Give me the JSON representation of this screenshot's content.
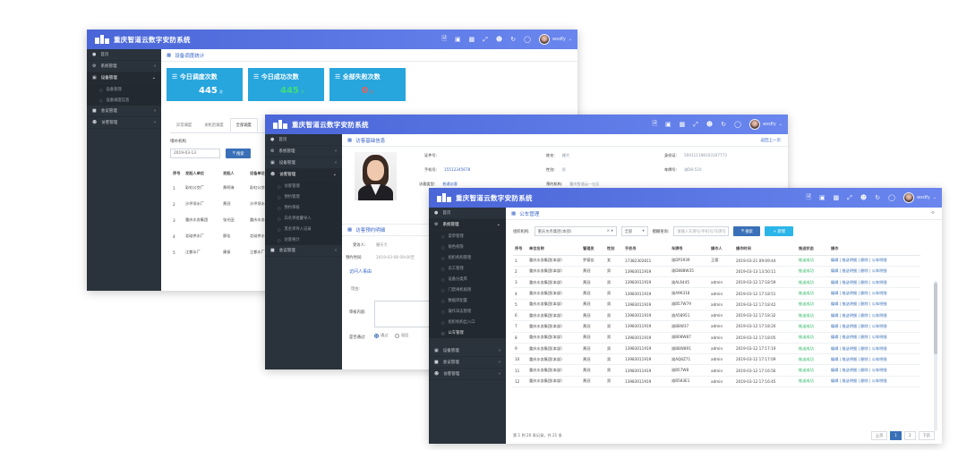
{
  "app_title": "重庆智道云数字安防系统",
  "user_name": "wxdfy",
  "topbar_icons": [
    "file-icon",
    "monitor-icon",
    "tv-icon",
    "expand-icon",
    "users-icon",
    "refresh-icon",
    "shield-icon"
  ],
  "window1": {
    "sidebar": [
      "首页",
      "系统管理",
      "设备管理",
      "设备管理",
      "设备调度信息",
      "会议管理",
      "访客管理"
    ],
    "panel_title": "设备调度统计",
    "tiles": [
      {
        "title": "今日调度次数",
        "value": "445",
        "unit": "次"
      },
      {
        "title": "今日成功次数",
        "value": "445",
        "unit": "次"
      },
      {
        "title": "全部失败次数",
        "value": "0",
        "unit": "次"
      }
    ],
    "tabs": [
      "异常调度",
      "关机后调度",
      "全部调度"
    ],
    "field_label": "增补机构",
    "date_value": "2019-03-13",
    "search_label": "搜索",
    "headers": [
      "序号",
      "发起人单位",
      "发起人",
      "设备单位"
    ],
    "rows": [
      [
        "1",
        "彩虹公交厂",
        "黄明海",
        "彩虹公交厂"
      ],
      [
        "2",
        "沙坪坝水厂",
        "黄冠",
        "沙坪坝水厂"
      ],
      [
        "3",
        "重庆水务集团",
        "张光田",
        "重庆水务集团"
      ],
      [
        "4",
        "北碚供水厂",
        "廖佳",
        "北碚供水厂"
      ],
      [
        "5",
        "江都水厂",
        "康振",
        "江都水厂"
      ]
    ]
  },
  "window2": {
    "sidebar_top": [
      "首页",
      "系统管理",
      "设备管理",
      "访客管理"
    ],
    "sidebar_sub": [
      "访客管理",
      "预约管理",
      "预约审核",
      "白名单批量导入",
      "黑名单导入记录",
      "访客统计"
    ],
    "sidebar_bottom": "会议管理",
    "panel_title": "访客基础信息",
    "back_link": "返回上一页",
    "fields": [
      {
        "k": "证件号:",
        "v": ""
      },
      {
        "k": "姓名:",
        "v": "姗大"
      },
      {
        "k": "身份证:",
        "v": "500111198103107773"
      },
      {
        "k": "手机号:",
        "v": "15512345678"
      },
      {
        "k": "性别:",
        "v": "男"
      },
      {
        "k": "车牌号:",
        "v": "渝D8-510"
      },
      {
        "k": "访客类型:",
        "v": "普通访客"
      },
      {
        "k": "预约机构:",
        "v": "重庆智道云一社区"
      }
    ],
    "form_title": "访客预约明细",
    "form_fields": [
      {
        "k": "受访人:",
        "v": "姗天大"
      },
      {
        "k": "预约时间:",
        "v": "2019-03-08 09:00至"
      }
    ],
    "visit_title": "访问人事由",
    "reason_label": "理由:",
    "opinion_label": "审核内容:",
    "approve_label": "是否通过:",
    "radio_yes": "通过",
    "radio_no": "驳回"
  },
  "window3": {
    "sidebar_top": [
      "首页",
      "系统管理"
    ],
    "sidebar_sub": [
      "菜单管理",
      "角色权限",
      "组织机构管理",
      "员工管理",
      "设备分类库",
      "门禁闸机规则",
      "数据库配置",
      "操作日志管理",
      "组织机构出入口",
      "公车管理"
    ],
    "sidebar_bottom": [
      "设备管理",
      "会议管理",
      "访客管理"
    ],
    "panel_title": "公车管理",
    "org_label": "组织机构:",
    "org_value": "重庆水务集团(本部)",
    "status_value": "全部",
    "keyword_label": "模糊查询:",
    "keyword_placeholder": "请输入车牌号/手机号/车牌号",
    "search_label": "搜索",
    "add_label": "+ 新增",
    "headers": [
      "序号",
      "单位名称",
      "管理员",
      "性别",
      "手机号",
      "车牌号",
      "操作人",
      "操作时间",
      "推送状态",
      "操作"
    ],
    "rows": [
      [
        "1",
        "重庆水务集团(本部)",
        "罗德佳",
        "女",
        "17382302811",
        "渝DP3939",
        "王德",
        "2019-03-21 09:09:44",
        "推送成功",
        "编辑 | 推送明细 | 删除 | 公车明细"
      ],
      [
        "2",
        "重庆水务集团(本部)",
        "黄冠",
        "男",
        "13983011919",
        "渝D888W35",
        "",
        "2019-03-13 13:50:11",
        "推送成功",
        "编辑 | 推送明细 | 删除 | 公车明细"
      ],
      [
        "3",
        "重庆水务集团(本部)",
        "黄冠",
        "男",
        "13983011919",
        "渝AL6445",
        "admin",
        "2019-03-12 17:18:59",
        "推送成功",
        "编辑 | 推送明细 | 删除 | 公车明细"
      ],
      [
        "4",
        "重庆水务集团(本部)",
        "黄冠",
        "男",
        "13983011919",
        "渝A9K318",
        "admin",
        "2019-03-12 17:18:51",
        "推送成功",
        "编辑 | 推送明细 | 删除 | 公车明细"
      ],
      [
        "5",
        "重庆水务集团(本部)",
        "黄冠",
        "男",
        "13983011919",
        "渝B57W79",
        "admin",
        "2019-03-12 17:18:42",
        "推送成功",
        "编辑 | 推送明细 | 删除 | 公车明细"
      ],
      [
        "6",
        "重庆水务集团(本部)",
        "黄冠",
        "男",
        "13983011919",
        "渝A58951",
        "admin",
        "2019-03-12 17:18:32",
        "推送成功",
        "编辑 | 推送明细 | 删除 | 公车明细"
      ],
      [
        "7",
        "重庆水务集团(本部)",
        "黄冠",
        "男",
        "13983011919",
        "渝B8W37",
        "admin",
        "2019-03-12 17:18:20",
        "推送成功",
        "编辑 | 推送明细 | 删除 | 公车明细"
      ],
      [
        "8",
        "重庆水务集团(本部)",
        "黄冠",
        "男",
        "13983011919",
        "渝B08W87",
        "admin",
        "2019-03-12 17:18:05",
        "推送成功",
        "编辑 | 推送明细 | 删除 | 公车明细"
      ],
      [
        "9",
        "重庆水务集团(本部)",
        "黄冠",
        "男",
        "13983011919",
        "渝B8W891",
        "admin",
        "2019-03-12 17:17:19",
        "推送成功",
        "编辑 | 推送明细 | 删除 | 公车明细"
      ],
      [
        "10",
        "重庆水务集团(本部)",
        "黄冠",
        "男",
        "13983011919",
        "渝AQ8Z71",
        "admin",
        "2019-03-12 17:17:09",
        "推送成功",
        "编辑 | 推送明细 | 删除 | 公车明细"
      ],
      [
        "11",
        "重庆水务集团(本部)",
        "黄冠",
        "男",
        "13983011919",
        "渝B57W8",
        "admin",
        "2019-03-12 17:16:56",
        "推送成功",
        "编辑 | 推送明细 | 删除 | 公车明细"
      ],
      [
        "12",
        "重庆水务集团(本部)",
        "黄冠",
        "男",
        "13983011919",
        "渝B583E1",
        "admin",
        "2019-03-12 17:16:45",
        "推送成功",
        "编辑 | 推送明细 | 删除 | 公车明细"
      ]
    ],
    "pager_info": "第 1 到 20 条记录，共 21 条",
    "pages": [
      "上页",
      "1",
      "2",
      "下页"
    ]
  }
}
